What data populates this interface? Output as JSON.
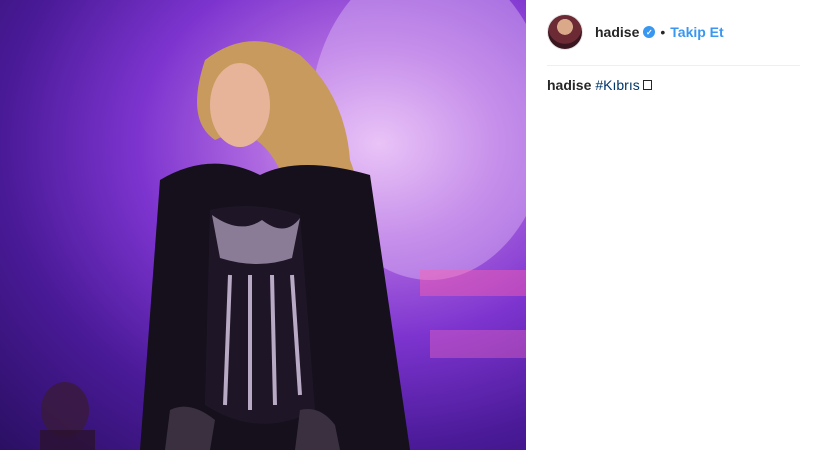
{
  "post": {
    "username": "hadise",
    "verified_icon": "verified-badge-icon",
    "separator": "•",
    "follow_label": "Takip Et",
    "caption": {
      "username": "hadise",
      "hashtag": "#Kıbrıs"
    }
  },
  "colors": {
    "link_blue": "#3897f0",
    "hashtag": "#003569",
    "text": "#262626"
  }
}
